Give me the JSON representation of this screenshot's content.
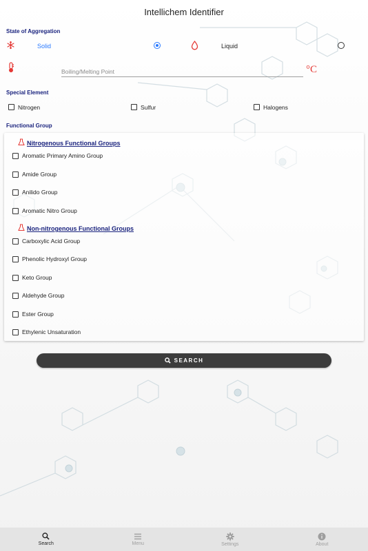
{
  "app": {
    "title": "Intellichem Identifier"
  },
  "state_of_aggregation": {
    "label": "State of Aggregation",
    "options": [
      {
        "label": "Solid",
        "selected": true,
        "icon": "snowflake-icon"
      },
      {
        "label": "Liquid",
        "selected": false,
        "icon": "droplet-icon"
      }
    ],
    "point_placeholder": "Boiling/Melting Point",
    "point_value": "",
    "unit": "°C"
  },
  "special_element": {
    "label": "Special Element",
    "options": [
      {
        "label": "Nitrogen",
        "checked": false
      },
      {
        "label": "Sulfur",
        "checked": false
      },
      {
        "label": "Halogens",
        "checked": false
      }
    ]
  },
  "functional_group": {
    "label": "Functional Group",
    "nitrogenous": {
      "heading": "Nitrogenous Functional Groups",
      "items": [
        "Aromatic Primary Amino Group",
        "Amide Group",
        "Anilido Group",
        "Aromatic Nitro Group"
      ]
    },
    "non_nitrogenous": {
      "heading": "Non-nitrogenous Functional Groups",
      "items": [
        "Carboxylic Acid Group",
        "Phenolic Hydroxyl Group",
        "Keto Group",
        "Aldehyde Group",
        "Ester Group",
        "Ethylenic Unsaturation"
      ]
    }
  },
  "search_button": {
    "label": "SEARCH"
  },
  "bottom_nav": [
    {
      "label": "Search",
      "icon": "search-icon",
      "active": true
    },
    {
      "label": "Menu",
      "icon": "menu-icon",
      "active": false
    },
    {
      "label": "Settings",
      "icon": "gear-icon",
      "active": false
    },
    {
      "label": "About",
      "icon": "info-icon",
      "active": false
    }
  ],
  "colors": {
    "accent": "#2979ff",
    "heading": "#1a237e",
    "icon_red": "#e53935",
    "button": "#3c3c3c",
    "nav_bg": "#e4e4e4"
  }
}
